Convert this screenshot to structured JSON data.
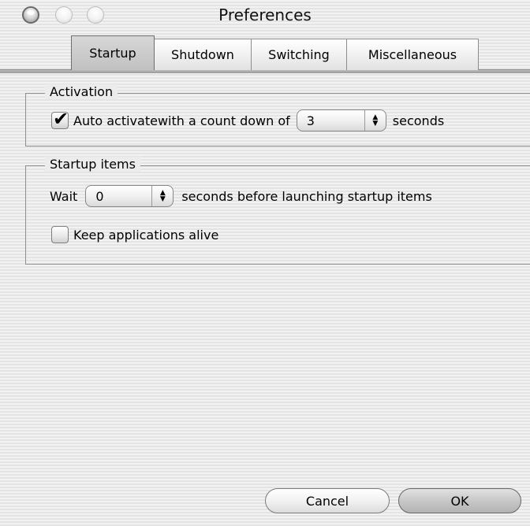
{
  "window": {
    "title": "Preferences"
  },
  "tabs": [
    {
      "label": "Startup",
      "selected": true
    },
    {
      "label": "Shutdown",
      "selected": false
    },
    {
      "label": "Switching",
      "selected": false
    },
    {
      "label": "Miscellaneous",
      "selected": false
    }
  ],
  "activation": {
    "group_title": "Activation",
    "auto_activate_label": "Auto activate",
    "auto_activate_checked": true,
    "countdown_prefix": "with a count down of",
    "countdown_value": "3",
    "countdown_suffix": "seconds"
  },
  "startup_items": {
    "group_title": "Startup items",
    "wait_label": "Wait",
    "wait_value": "0",
    "wait_suffix": "seconds before launching startup items",
    "keep_alive_label": "Keep applications alive",
    "keep_alive_checked": false
  },
  "buttons": {
    "cancel": "Cancel",
    "ok": "OK"
  }
}
